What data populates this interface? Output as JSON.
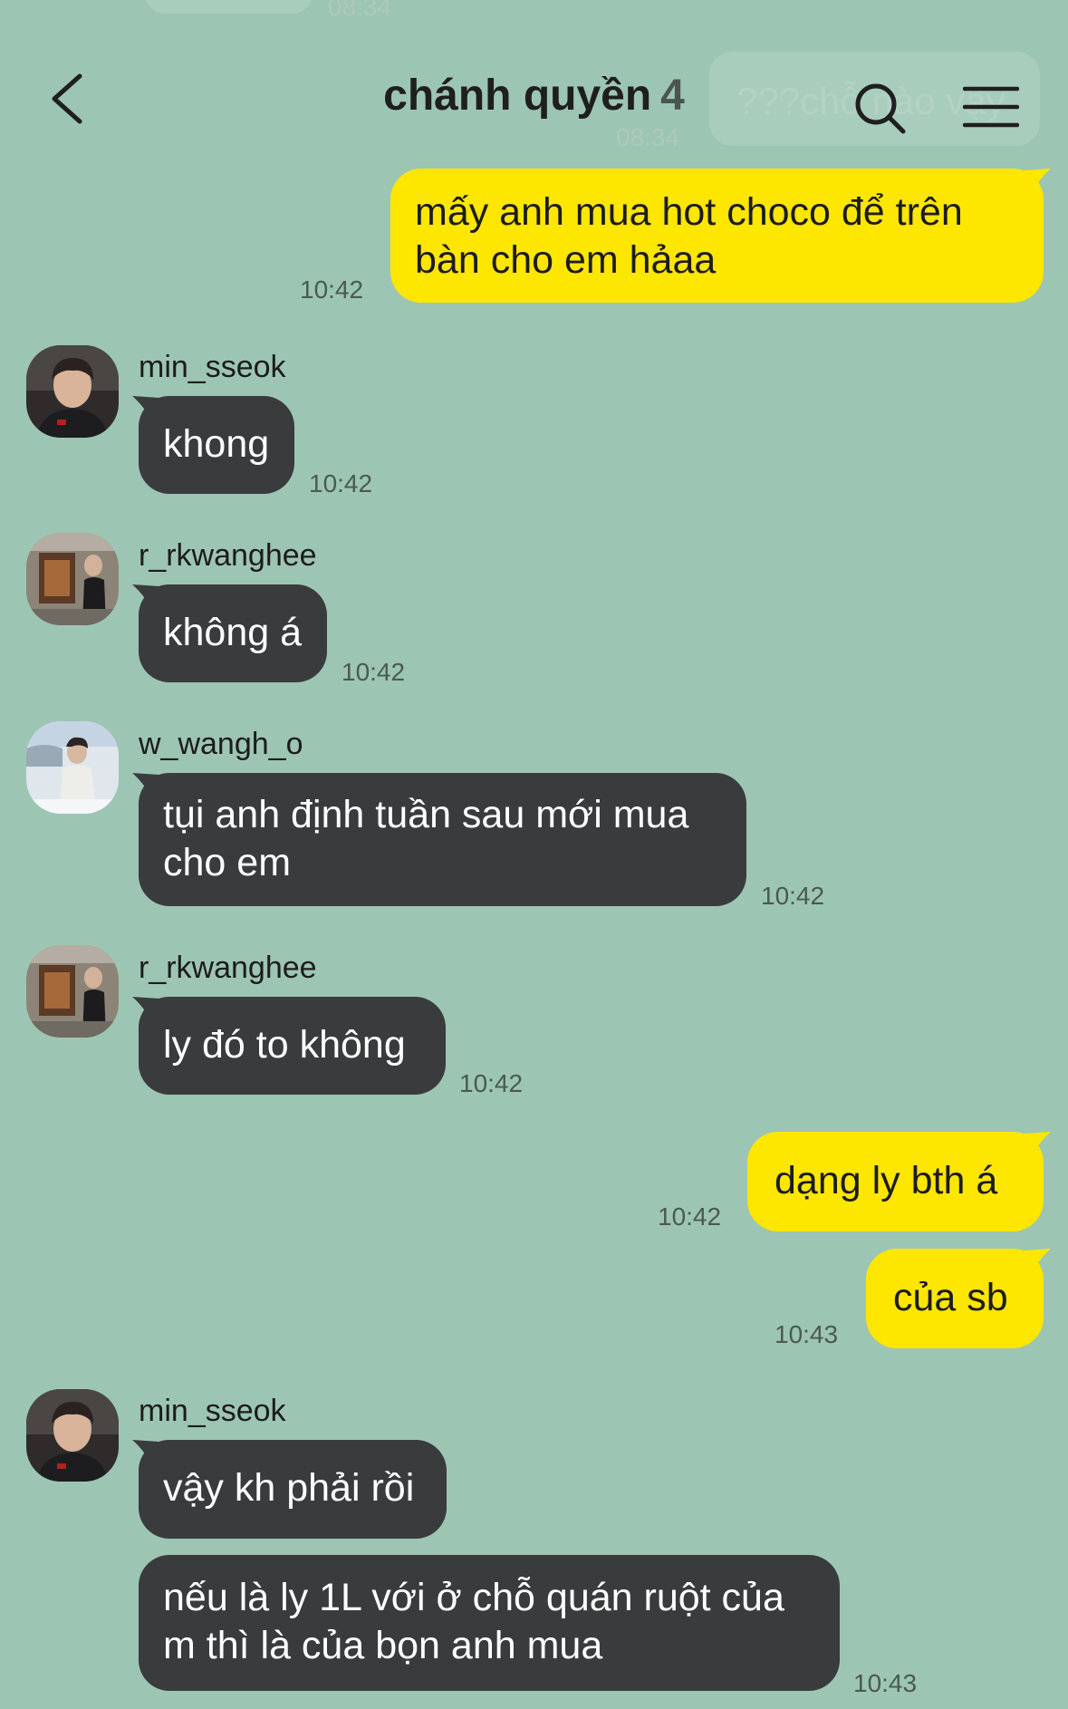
{
  "ghost": {
    "time_top": "08:34",
    "text": "???chỗ nào vậy",
    "time": "08:34"
  },
  "header": {
    "title": "chánh quyền",
    "member_count": "4"
  },
  "messages": [
    {
      "direction": "out",
      "text": "mấy anh mua hot choco để trên\nbàn cho em hảaa",
      "time": "10:42"
    },
    {
      "direction": "in",
      "sender": "min_sseok",
      "avatar": "avatar-min-sseok",
      "text": "khong",
      "time": "10:42"
    },
    {
      "direction": "in",
      "sender": "r_rkwanghee",
      "avatar": "avatar-r-rkwanghee",
      "text": "không á",
      "time": "10:42"
    },
    {
      "direction": "in",
      "sender": "w_wangh_o",
      "avatar": "avatar-w-wangh-o",
      "text": "tụi anh định tuần sau mới mua\ncho em",
      "time": "10:42"
    },
    {
      "direction": "in",
      "sender": "r_rkwanghee",
      "avatar": "avatar-r-rkwanghee",
      "text": "ly đó to không",
      "time": "10:42"
    },
    {
      "direction": "out",
      "text": "dạng ly bth á",
      "time": "10:42"
    },
    {
      "direction": "out",
      "text": "của sb",
      "time": "10:43"
    },
    {
      "direction": "in",
      "sender": "min_sseok",
      "avatar": "avatar-min-sseok",
      "text": "vậy kh phải rồi",
      "time": ""
    },
    {
      "direction": "in",
      "text": "nếu là ly 1L với ở chỗ quán ruột của\nm thì là của bọn anh mua",
      "time": "10:43"
    }
  ],
  "colors": {
    "background": "#9dc5b3",
    "outgoing_bubble": "#fde600",
    "incoming_bubble": "#3a3b3d"
  }
}
